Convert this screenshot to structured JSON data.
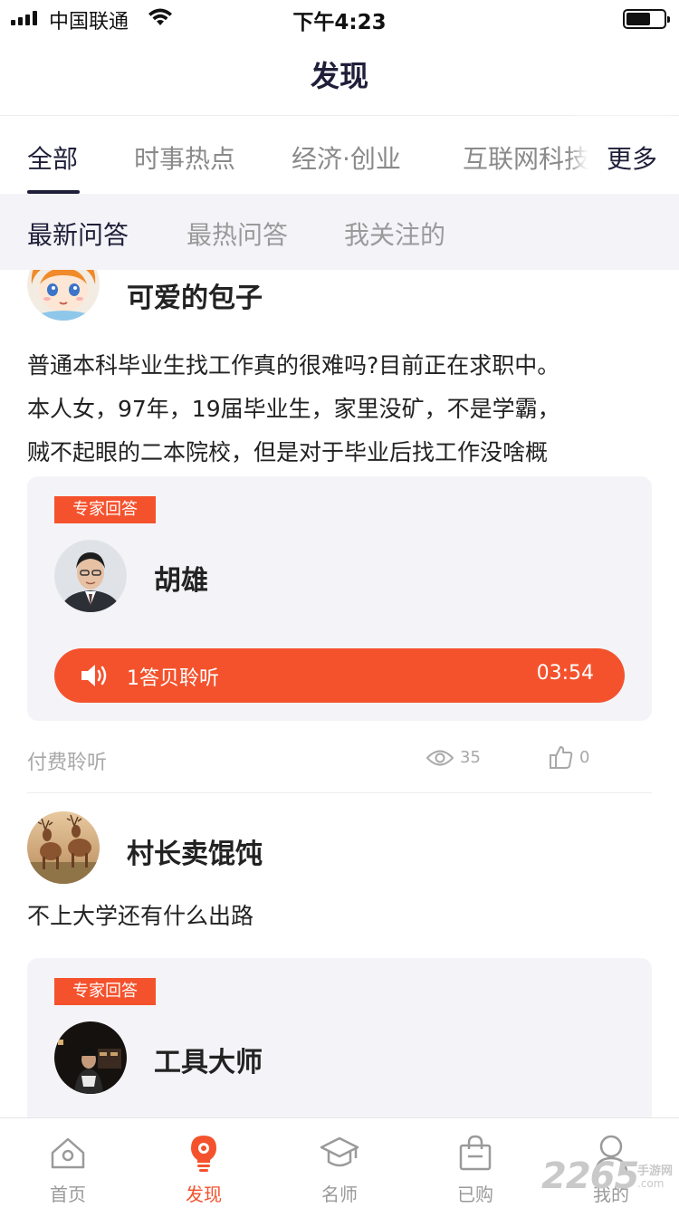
{
  "status_bar": {
    "carrier": "中国联通",
    "time": "下午4:23"
  },
  "nav": {
    "title": "发现"
  },
  "category_tabs": [
    {
      "label": "全部",
      "active": true
    },
    {
      "label": "时事热点",
      "active": false
    },
    {
      "label": "经济·创业",
      "active": false
    },
    {
      "label": "互联网科技",
      "active": false
    }
  ],
  "category_more": "更多",
  "sub_tabs": [
    {
      "label": "最新问答",
      "active": true
    },
    {
      "label": "最热问答",
      "active": false
    },
    {
      "label": "我关注的",
      "active": false
    }
  ],
  "posts": [
    {
      "user": "可爱的包子",
      "question_lines": [
        "普通本科毕业生找工作真的很难吗?目前正在求职中。",
        "本人女，97年，19届毕业生，家里没矿，不是学霸，",
        "贼不起眼的二本院校，但是对于毕业后找工作没啥概"
      ],
      "answer": {
        "tag": "专家回答",
        "expert": "胡雄",
        "listen_label": "1答贝聆听",
        "duration": "03:54"
      },
      "footer": {
        "paid": "付费聆听",
        "views": "35",
        "likes": "0"
      }
    },
    {
      "user": "村长卖馄饨",
      "question_lines": [
        "不上大学还有什么出路"
      ],
      "answer": {
        "tag": "专家回答",
        "expert": "工具大师"
      }
    }
  ],
  "tab_bar": [
    {
      "label": "首页",
      "icon": "home-icon",
      "active": false
    },
    {
      "label": "发现",
      "icon": "lightbulb-icon",
      "active": true
    },
    {
      "label": "名师",
      "icon": "graduation-cap-icon",
      "active": false
    },
    {
      "label": "已购",
      "icon": "shopping-bag-icon",
      "active": false
    },
    {
      "label": "我的",
      "icon": "user-icon",
      "active": false
    }
  ],
  "watermark": {
    "number": "2265",
    "line1": "手游网",
    "line2": ".com"
  },
  "colors": {
    "accent": "#f4522d",
    "title": "#1f1f3a",
    "card_bg": "#f4f4f8"
  }
}
